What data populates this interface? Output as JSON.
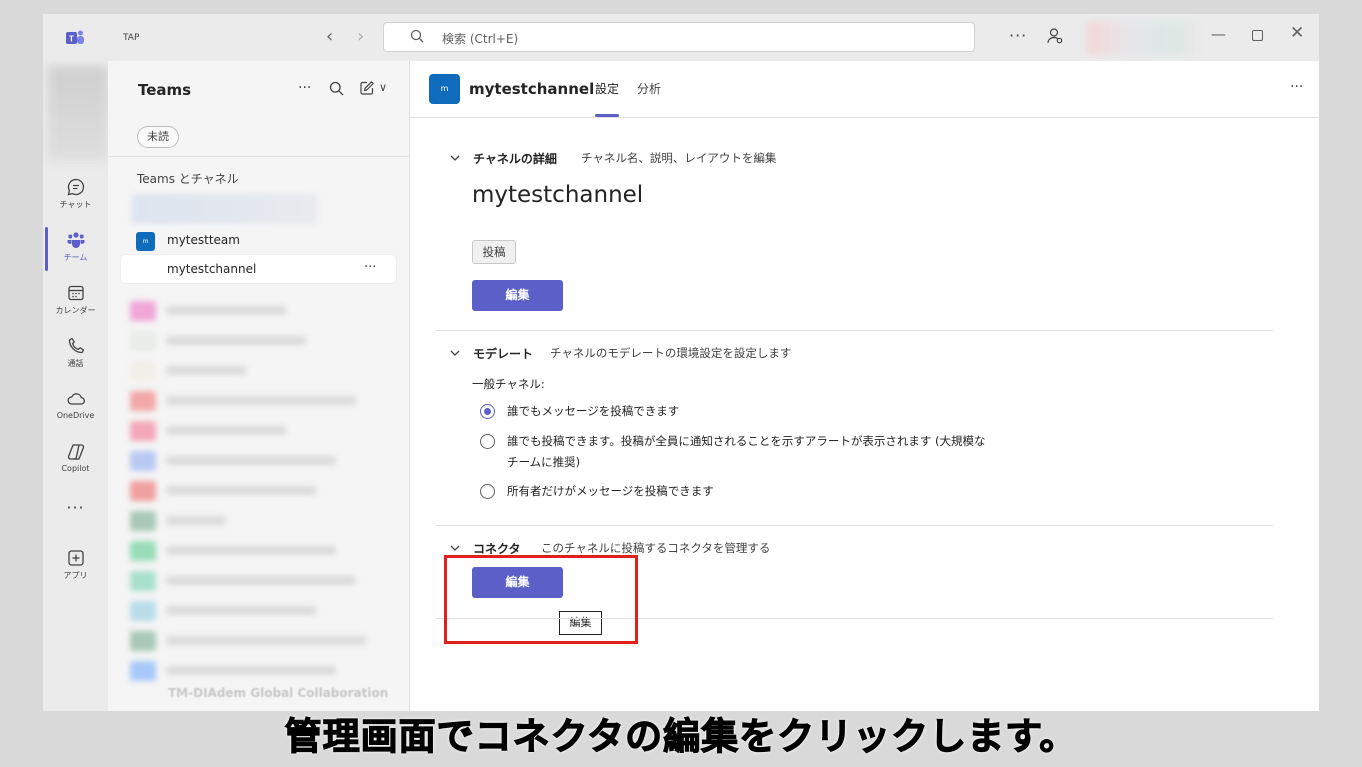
{
  "titlebar": {
    "org_badge": "TAP",
    "search_placeholder": "検索 (Ctrl+E)"
  },
  "rail": {
    "items": [
      {
        "label": "チャット",
        "icon": "chat-icon"
      },
      {
        "label": "チーム",
        "icon": "teams-icon",
        "active": true
      },
      {
        "label": "カレンダー",
        "icon": "calendar-icon"
      },
      {
        "label": "通話",
        "icon": "phone-icon"
      },
      {
        "label": "OneDrive",
        "icon": "cloud-icon"
      },
      {
        "label": "Copilot",
        "icon": "copilot-icon"
      },
      {
        "label": "アプリ",
        "icon": "add-apps-icon"
      }
    ]
  },
  "list": {
    "title": "Teams",
    "unread_filter": "未読",
    "section": "Teams とチャネル",
    "team": {
      "avatar": "m",
      "name": "mytestteam"
    },
    "channel": {
      "name": "mytestchannel"
    },
    "last_team": "TM-DIAdem Global Collaboration"
  },
  "main": {
    "channel_avatar": "m",
    "channel_title": "mytestchannel",
    "tabs": [
      {
        "label": "設定",
        "active": true
      },
      {
        "label": "分析",
        "active": false
      }
    ],
    "details": {
      "title": "チャネルの詳細",
      "desc": "チャネル名、説明、レイアウトを編集",
      "name": "mytestchannel",
      "post_chip": "投稿",
      "edit_label": "編集"
    },
    "moderation": {
      "title": "モデレート",
      "desc": "チャネルのモデレートの環境設定を設定します",
      "general_label": "一般チャネル:",
      "options": [
        {
          "line1": "誰でもメッセージを投稿できます",
          "line2": "",
          "checked": true
        },
        {
          "line1": "誰でも投稿できます。投稿が全員に通知されることを示すアラートが表示されます (大規模な",
          "line2": "チームに推奨)",
          "checked": false
        },
        {
          "line1": "所有者だけがメッセージを投稿できます",
          "line2": "",
          "checked": false
        }
      ]
    },
    "connectors": {
      "title": "コネクタ",
      "desc": "このチャネルに投稿するコネクタを管理する",
      "edit_label": "編集",
      "tooltip": "編集"
    }
  },
  "caption": "管理画面でコネクタの編集をクリックします。",
  "colors": {
    "accent": "#5b5fc7",
    "highlight": "#e0201c",
    "team_avatar": "#0f6cbd"
  }
}
